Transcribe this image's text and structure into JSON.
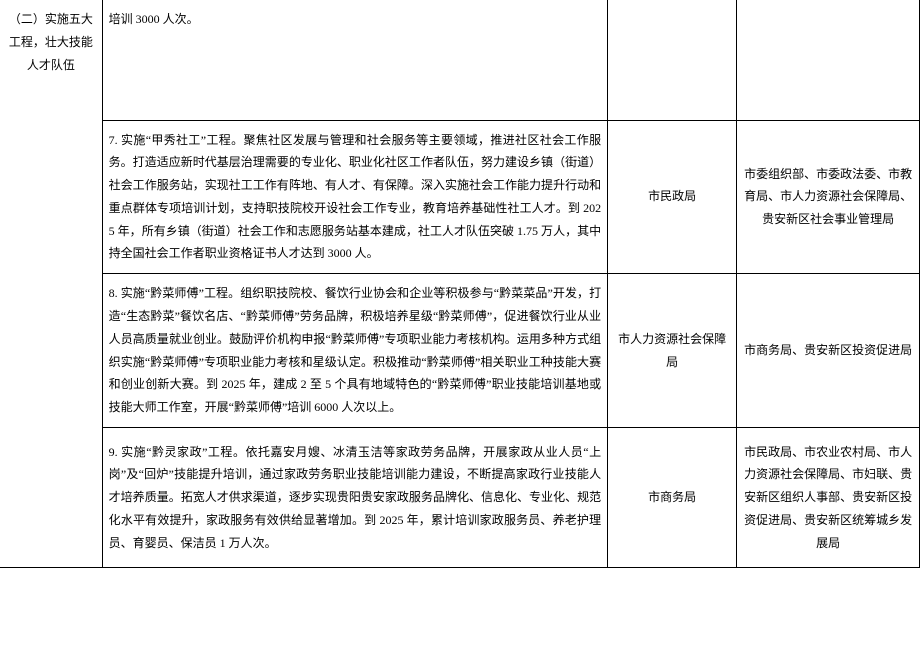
{
  "category": "（二）实施五大工程，壮大技能人才队伍",
  "row_top": {
    "desc": "培训 3000 人次。",
    "dept1": "",
    "dept2": ""
  },
  "row7": {
    "desc": "7. 实施“甲秀社工”工程。聚焦社区发展与管理和社会服务等主要领域，推进社区社会工作服务。打造适应新时代基层治理需要的专业化、职业化社区工作者队伍，努力建设乡镇（街道）社会工作服务站，实现社工工作有阵地、有人才、有保障。深入实施社会工作能力提升行动和重点群体专项培训计划，支持职技院校开设社会工作专业，教育培养基础性社工人才。到 2025 年，所有乡镇（街道）社会工作和志愿服务站基本建成，社工人才队伍突破 1.75 万人，其中持全国社会工作者职业资格证书人才达到 3000 人。",
    "dept1": "市民政局",
    "dept2": "市委组织部、市委政法委、市教育局、市人力资源社会保障局、贵安新区社会事业管理局"
  },
  "row8": {
    "desc": "8. 实施“黔菜师傅”工程。组织职技院校、餐饮行业协会和企业等积极参与“黔菜菜品”开发，打造“生态黔菜”餐饮名店、“黔菜师傅”劳务品牌，积极培养星级“黔菜师傅”，促进餐饮行业从业人员高质量就业创业。鼓励评价机构申报“黔菜师傅”专项职业能力考核机构。运用多种方式组织实施“黔菜师傅”专项职业能力考核和星级认定。积极推动“黔菜师傅”相关职业工种技能大赛和创业创新大赛。到 2025 年，建成 2 至 5 个具有地域特色的“黔菜师傅”职业技能培训基地或技能大师工作室，开展“黔菜师傅”培训 6000 人次以上。",
    "dept1": "市人力资源社会保障局",
    "dept2": "市商务局、贵安新区投资促进局"
  },
  "row9": {
    "desc": "9. 实施“黔灵家政”工程。依托嘉安月嫂、冰清玉洁等家政劳务品牌，开展家政从业人员“上岗”及“回炉”技能提升培训，通过家政劳务职业技能培训能力建设，不断提高家政行业技能人才培养质量。拓宽人才供求渠道，逐步实现贵阳贵安家政服务品牌化、信息化、专业化、规范化水平有效提升，家政服务有效供给显著增加。到 2025 年，累计培训家政服务员、养老护理员、育婴员、保洁员 1 万人次。",
    "dept1": "市商务局",
    "dept2": "市民政局、市农业农村局、市人力资源社会保障局、市妇联、贵安新区组织人事部、贵安新区投资促进局、贵安新区统筹城乡发展局"
  }
}
